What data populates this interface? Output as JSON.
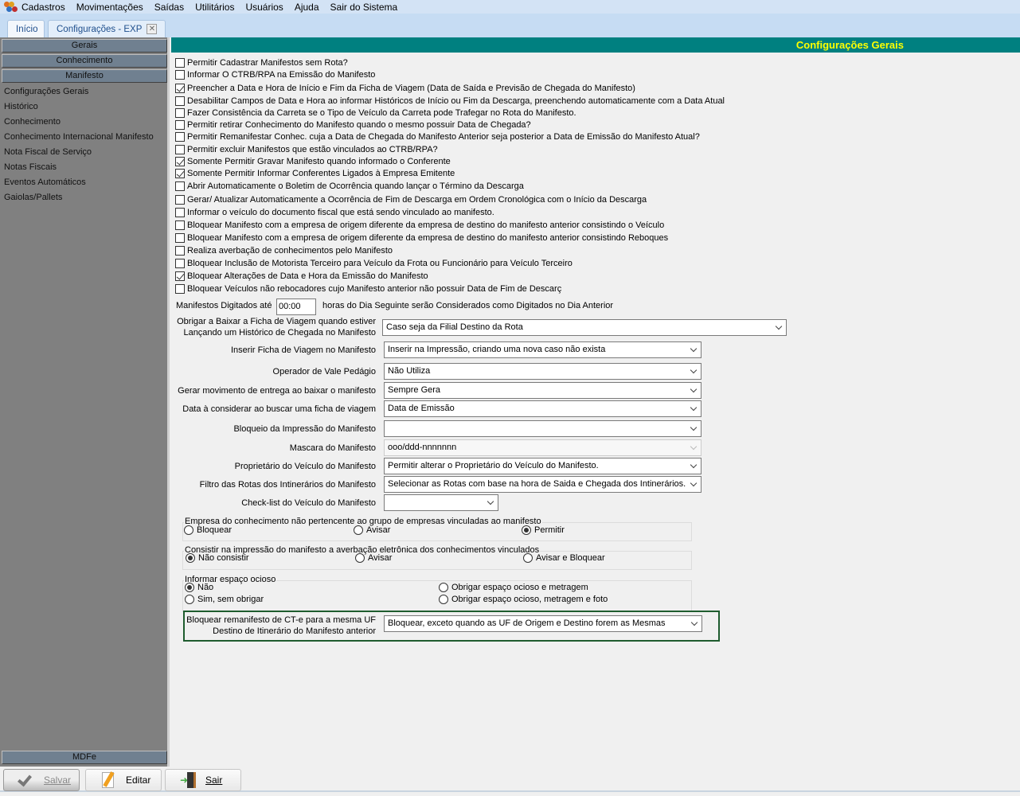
{
  "menu": [
    "Cadastros",
    "Movimentações",
    "Saídas",
    "Utilitários",
    "Usuários",
    "Ajuda",
    "Sair do Sistema"
  ],
  "tabs": {
    "inicio": "Início",
    "config": "Configurações - EXP"
  },
  "sidebar": {
    "headers": {
      "gerais": "Gerais",
      "conhecimento": "Conhecimento",
      "manifesto": "Manifesto",
      "mdfe": "MDFe"
    },
    "items": [
      "Configurações Gerais",
      "Histórico",
      "Conhecimento",
      "Conhecimento Internacional Manifesto",
      "Nota Fiscal de Serviço",
      "Notas Fiscais",
      "Eventos Automáticos",
      "Gaiolas/Pallets"
    ]
  },
  "main": {
    "title": "Configurações Gerais",
    "checkboxes": [
      {
        "label": "Permitir Cadastrar Manifestos sem Rota?",
        "checked": false
      },
      {
        "label": "Informar O CTRB/RPA na Emissão do Manifesto",
        "checked": false
      },
      {
        "label": "Preencher a Data e Hora de Início e Fim da Ficha de Viagem (Data de Saída e Previsão de Chegada do Manifesto)",
        "checked": true
      },
      {
        "label": "Desabilitar Campos de Data e Hora ao informar Históricos de Início ou Fim da Descarga, preenchendo automaticamente com a Data Atual",
        "checked": false
      },
      {
        "label": "Fazer Consistência da Carreta  se o Tipo de Veículo da Carreta pode Trafegar no Rota do Manifesto.",
        "checked": false
      },
      {
        "label": "Permitir retirar Conhecimento do Manifesto quando o mesmo possuir Data de Chegada?",
        "checked": false
      },
      {
        "label": "Permitir Remanifestar Conhec. cuja a Data de Chegada do Manifesto Anterior seja posterior a Data de Emissão do Manifesto Atual?",
        "checked": false
      },
      {
        "label": "Permitir excluir Manifestos que estão vinculados ao CTRB/RPA?",
        "checked": false
      },
      {
        "label": "Somente Permitir Gravar Manifesto quando informado o Conferente",
        "checked": true
      },
      {
        "label": "Somente Permitir Informar Conferentes Ligados à Empresa Emitente",
        "checked": true
      },
      {
        "label": "Abrir Automaticamente o Boletim de Ocorrência quando lançar o Término da Descarga",
        "checked": false
      },
      {
        "label": "Gerar/ Atualizar Automaticamente a Ocorrência de Fim de Descarga em Ordem Cronológica com o Início da Descarga",
        "checked": false
      },
      {
        "label": "Informar o veículo do documento fiscal que está sendo vinculado ao manifesto.",
        "checked": false
      },
      {
        "label": "Bloquear Manifesto com a empresa de origem diferente da empresa de destino do manifesto anterior consistindo o Veículo",
        "checked": false
      },
      {
        "label": "Bloquear Manifesto com a empresa de origem diferente da empresa de destino do manifesto anterior consistindo Reboques",
        "checked": false
      },
      {
        "label": "Realiza averbação de conhecimentos pelo Manifesto",
        "checked": false
      },
      {
        "label": "Bloquear Inclusão de Motorista Terceiro para Veículo da Frota ou Funcionário para Veículo Terceiro",
        "checked": false
      },
      {
        "label": "Bloquear Alterações de Data e Hora da Emissão do Manifesto",
        "checked": true
      },
      {
        "label": "Bloquear Veículos não rebocadores cujo Manifesto anterior não possuir Data de Fim de Descarç",
        "checked": false
      }
    ],
    "digitados": {
      "label": "Manifestos Digitados até",
      "value": "00:00",
      "suffix": "horas do Dia Seguinte serão Considerados como Digitados no Dia Anterior"
    },
    "selects": [
      {
        "label": "Obrigar a Baixar a Ficha de Viagem quando estiver\nLançando um Histórico de Chegada no Manifesto",
        "value": "Caso seja da Filial Destino da Rota"
      },
      {
        "label": "Inserir Ficha de Viagem no Manifesto",
        "value": "Inserir na Impressão, criando uma nova caso não exista"
      },
      {
        "label": "Operador de Vale Pedágio",
        "value": "Não Utiliza"
      },
      {
        "label": "Gerar movimento de entrega ao baixar o manifesto",
        "value": "Sempre Gera"
      },
      {
        "label": "Data à considerar ao buscar uma ficha de viagem",
        "value": "Data de Emissão"
      },
      {
        "label": "Bloqueio da Impressão do Manifesto",
        "value": ""
      },
      {
        "label": "Mascara do Manifesto",
        "value": "ooo/ddd-nnnnnnn",
        "disabled": true
      },
      {
        "label": "Proprietário do Veículo do Manifesto",
        "value": "Permitir alterar o Proprietário do Veículo do Manifesto."
      },
      {
        "label": "Filtro das Rotas dos Intinerários do Manifesto",
        "value": "Selecionar as Rotas com base na hora de Saida e Chegada dos Intinerários."
      },
      {
        "label": "Check-list do Veículo do Manifesto",
        "value": ""
      }
    ],
    "groups": [
      {
        "title": "Empresa do conhecimento não pertencente ao grupo de empresas vinculadas ao manifesto",
        "options": [
          "Bloquear",
          "Avisar",
          "Permitir"
        ],
        "selected": 2
      },
      {
        "title": "Consistir na impressão do manifesto a averbação eletrônica dos conhecimentos vinculados",
        "options": [
          "Não consistir",
          "Avisar",
          "Avisar e Bloquear"
        ],
        "selected": 0
      },
      {
        "title": "Informar espaço ocioso",
        "options": [
          "Não",
          "Sim, sem obrigar",
          "Obrigar espaço ocioso e metragem",
          "Obrigar espaço ocioso, metragem e foto"
        ],
        "selected": 0
      }
    ],
    "remanifesto": {
      "label1": "Bloquear remanifesto de CT-e para a mesma UF",
      "label2": "Destino de Itinerário do Manifesto anterior",
      "value": "Bloquear, exceto quando as UF de Origem e Destino forem as Mesmas",
      "highlight": "#1e5c2e"
    }
  },
  "toolbar": {
    "salvar": "Salvar",
    "editar": "Editar",
    "sair": "Sair"
  },
  "colors": {
    "header": "#008080",
    "title": "#ffff00",
    "sidebar": "#808080"
  }
}
